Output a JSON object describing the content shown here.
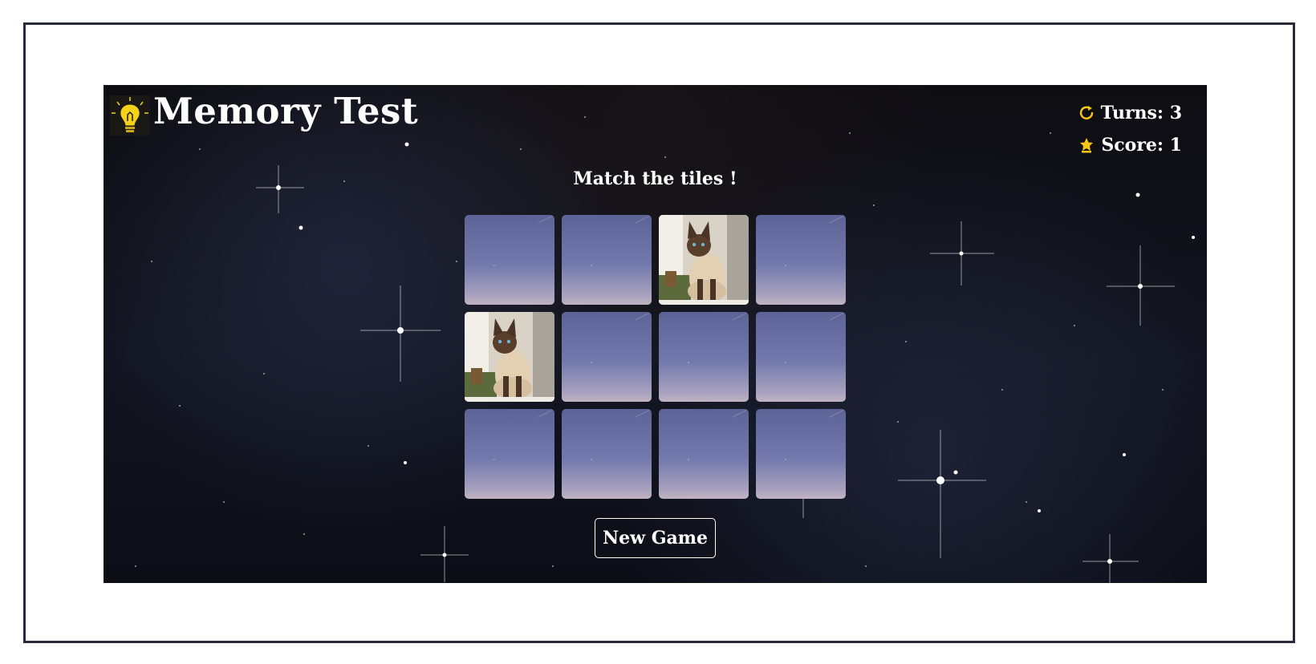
{
  "header": {
    "title": "Memory Test",
    "logo_icon": "lightbulb-icon"
  },
  "stats": {
    "turns_label": "Turns: 3",
    "turns_icon": "refresh-icon",
    "score_label": "Score: 1",
    "score_icon": "trophy-icon"
  },
  "instruction": "Match the tiles !",
  "board": {
    "rows": 3,
    "cols": 4,
    "tiles": [
      {
        "state": "face-down"
      },
      {
        "state": "face-down"
      },
      {
        "state": "face-up",
        "image": "siamese-cat"
      },
      {
        "state": "face-down"
      },
      {
        "state": "face-up",
        "image": "siamese-cat"
      },
      {
        "state": "face-down"
      },
      {
        "state": "face-down"
      },
      {
        "state": "face-down"
      },
      {
        "state": "face-down"
      },
      {
        "state": "face-down"
      },
      {
        "state": "face-down"
      },
      {
        "state": "face-down"
      }
    ]
  },
  "actions": {
    "new_game_label": "New Game"
  },
  "colors": {
    "accent": "#f5c518",
    "frame_border": "#262a3a",
    "tile_back_top": "#5c6396",
    "tile_back_bottom": "#c1b3c2"
  }
}
